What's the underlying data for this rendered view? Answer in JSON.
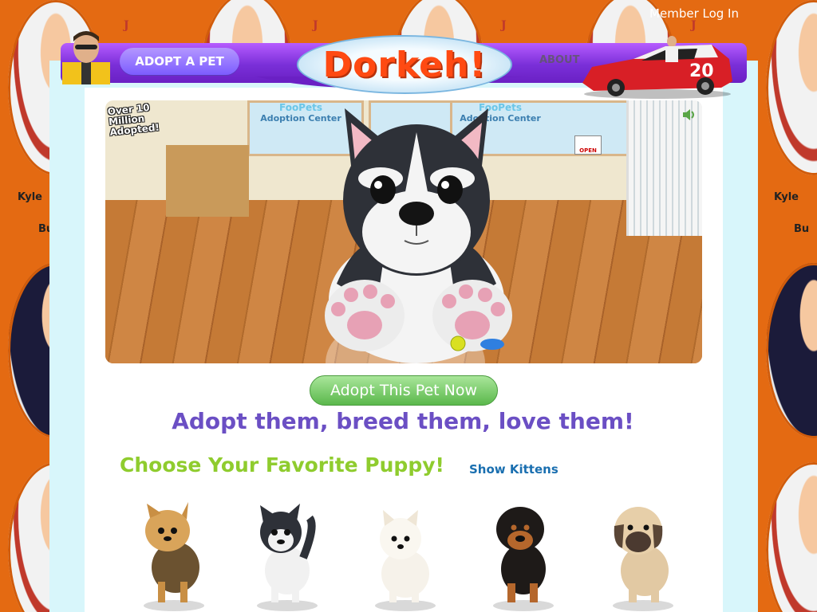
{
  "header": {
    "member_login": "Member Log In",
    "adopt_pet": "ADOPT A PET",
    "about": "ABOUT",
    "logo": "Dorkeh!"
  },
  "background": {
    "name_tag": "Kyle",
    "name_tag_2": "Bu"
  },
  "hero": {
    "badge": "Over 10 Million Adopted!",
    "banner_brand": "FooPets",
    "banner_sub": "Adoption Center",
    "open_sign": "OPEN"
  },
  "cta": {
    "adopt_now": "Adopt This Pet Now"
  },
  "tagline": "Adopt them, breed them, love them!",
  "choose": {
    "heading": "Choose Your Favorite Puppy!",
    "show_kittens": "Show Kittens"
  },
  "colors": {
    "background": "#e46a12",
    "nav_purple": "#7a2fd8",
    "logo_orange": "#ff4a12",
    "tagline_purple": "#6b4fc4",
    "choose_green": "#8fcc2e",
    "link_blue": "#1a6fb0",
    "cta_green": "#5bb84c"
  },
  "puppies": [
    {
      "breed_icon": "yorkie-puppy-icon"
    },
    {
      "breed_icon": "husky-puppy-icon"
    },
    {
      "breed_icon": "westie-puppy-icon"
    },
    {
      "breed_icon": "rottweiler-puppy-icon"
    },
    {
      "breed_icon": "mastiff-puppy-icon"
    }
  ]
}
